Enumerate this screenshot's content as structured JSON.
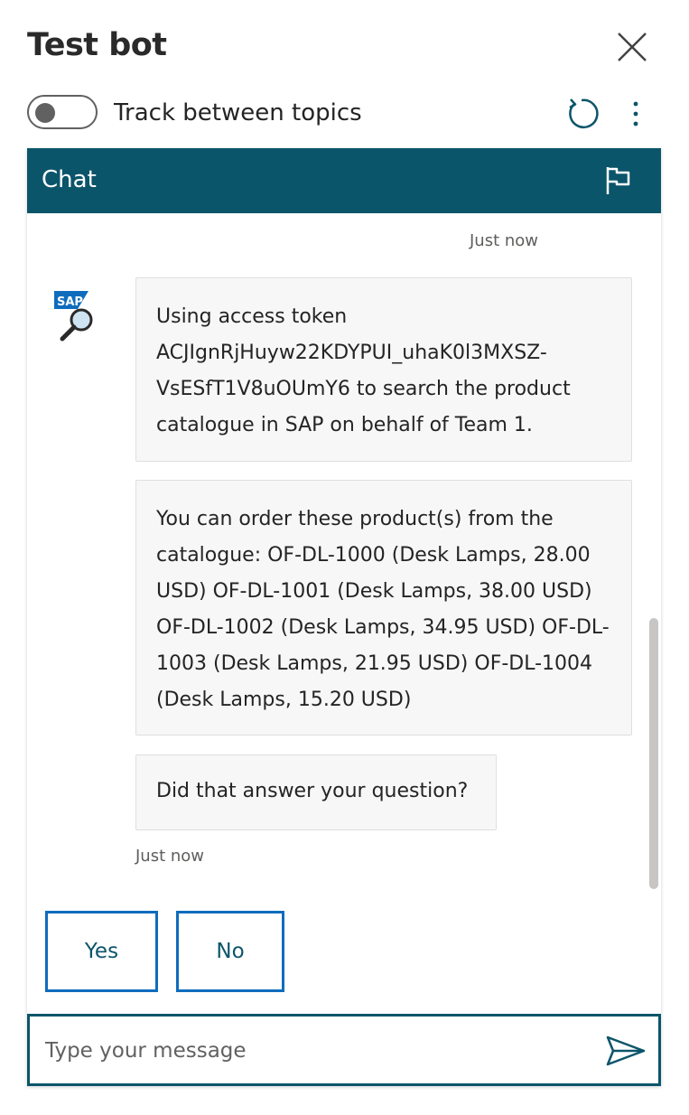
{
  "header": {
    "title": "Test bot",
    "toggle_label": "Track between topics",
    "toggle_on": false
  },
  "chat": {
    "title": "Chat",
    "timestamp_top": "Just now",
    "messages": [
      {
        "text": "Using access token ACJIgnRjHuyw22KDYPUI_uhaK0l3MXSZ-VsESfT1V8uOUmY6 to search the product catalogue in SAP on behalf of Team 1."
      },
      {
        "text": "You can order these product(s) from the catalogue: OF-DL-1000 (Desk Lamps, 28.00 USD) OF-DL-1001 (Desk Lamps, 38.00 USD) OF-DL-1002 (Desk Lamps, 34.95 USD) OF-DL-1003 (Desk Lamps, 21.95 USD) OF-DL-1004 (Desk Lamps, 15.20 USD)"
      },
      {
        "text": "Did that answer your question?"
      }
    ],
    "timestamp_bottom": "Just now",
    "avatar_label": "SAP",
    "choices": [
      "Yes",
      "No"
    ],
    "input_placeholder": "Type your message"
  },
  "icons": {
    "close": "close-icon",
    "refresh": "refresh-icon",
    "more": "more-vertical-icon",
    "flag": "flag-icon",
    "send": "send-icon",
    "avatar": "sap-search-avatar"
  },
  "colors": {
    "header_bg": "#0b556a",
    "choice_border": "#0f6cbd",
    "bubble_bg": "#f7f7f7"
  }
}
